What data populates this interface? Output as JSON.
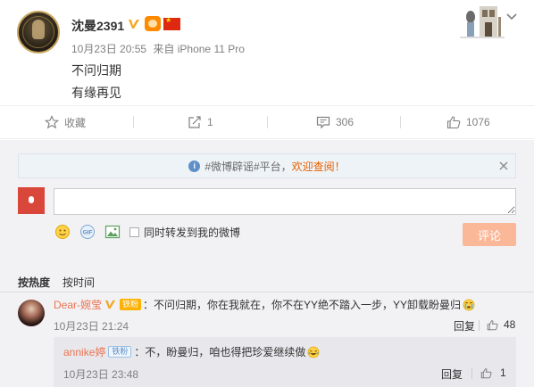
{
  "post": {
    "username": "沈曼2391",
    "date": "10月23日 20:55",
    "source": "来自 iPhone 11 Pro",
    "lines": [
      "不问归期",
      "有缘再见"
    ]
  },
  "actions": {
    "favorite": "收藏",
    "repost_count": "1",
    "comment_count": "306",
    "like_count": "1076"
  },
  "comments_section": {
    "notice_prefix": "#微博辟谣#平台，",
    "notice_highlight": "欢迎查阅！",
    "input_placeholder": "",
    "repost_label": "同时转发到我的微博",
    "submit_label": "评论",
    "sort_tabs": [
      "按热度",
      "按时间"
    ]
  },
  "comments": [
    {
      "author": "Dear-婉莹",
      "badge": "铁粉",
      "text": "：不问归期，你在我就在，你不在YY绝不踏入一步，YY卸载盼曼归",
      "time": "10月23日 21:24",
      "reply_label": "回复",
      "likes": "48"
    }
  ],
  "nested_reply": {
    "author": "annike婷",
    "badge": "铁粉",
    "text": "：不，盼曼归，咱也得把珍爱继续做",
    "time": "10月23日 23:48",
    "reply_label": "回复",
    "likes": "1"
  },
  "colors": {
    "link": "#eb7350",
    "notice_highlight": "#e86100",
    "submit_bg": "#fbb899",
    "comment_bg": "#f2f2f5"
  }
}
